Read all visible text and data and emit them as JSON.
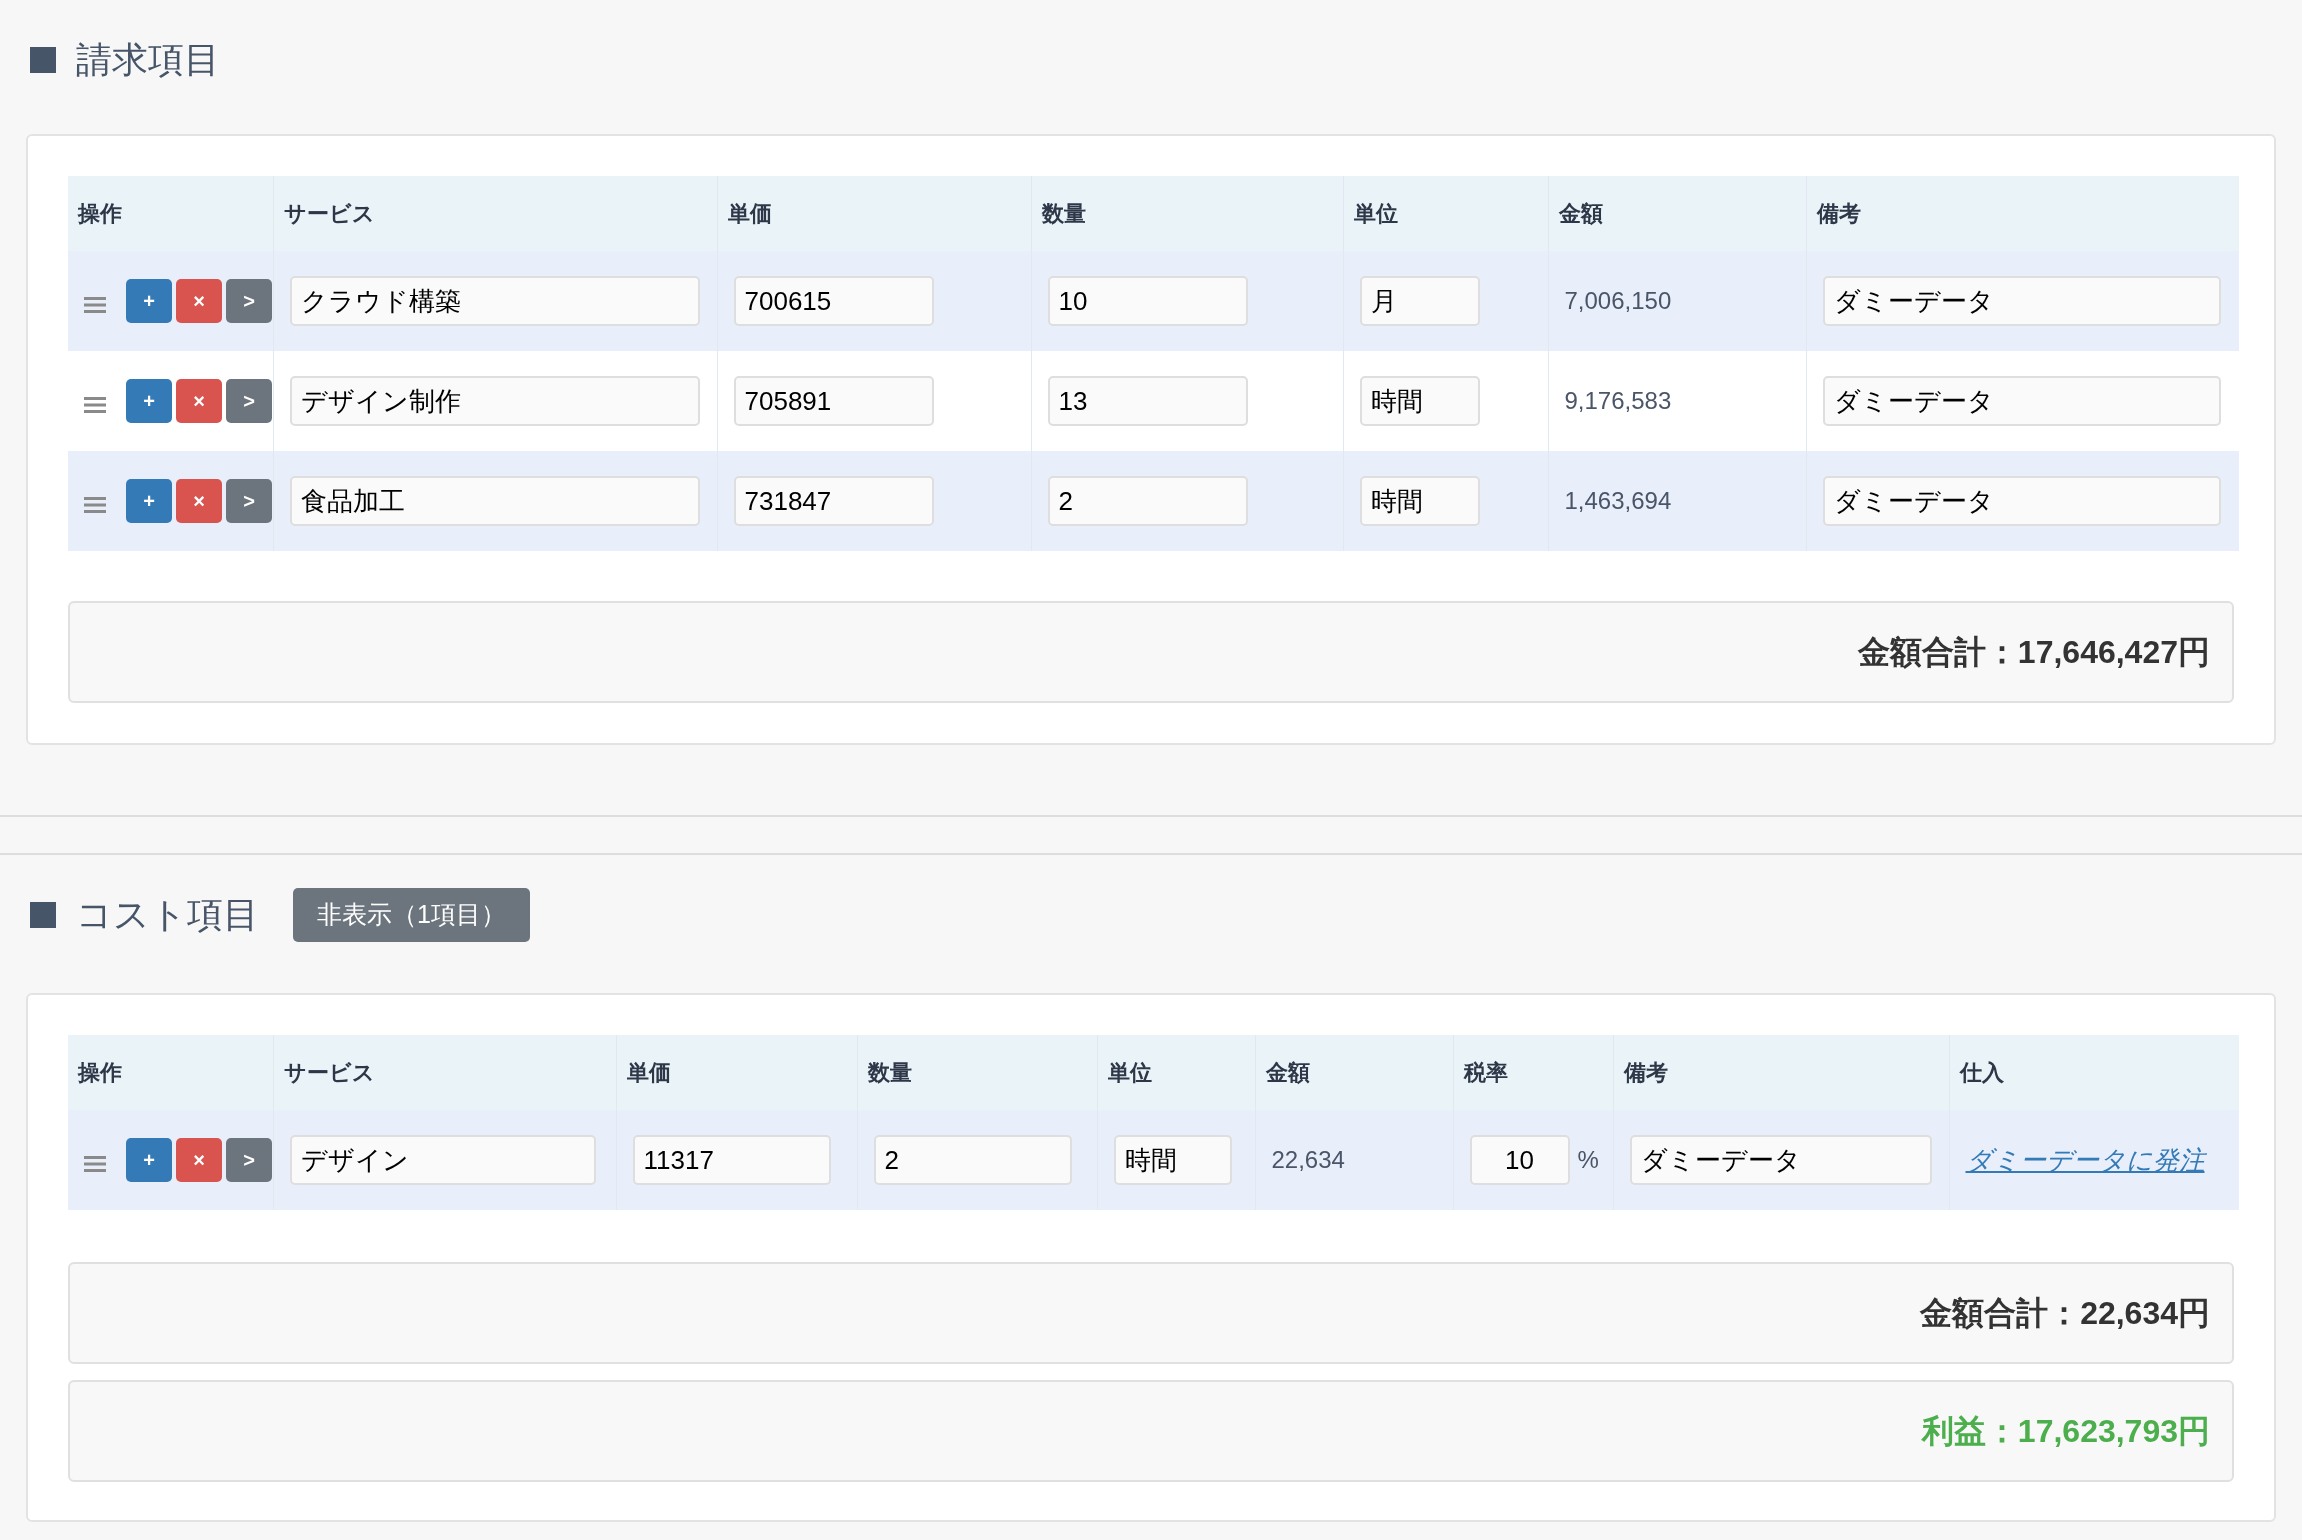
{
  "billing": {
    "title": "請求項目",
    "columns": [
      "操作",
      "サービス",
      "単価",
      "数量",
      "単位",
      "金額",
      "備考"
    ],
    "rows": [
      {
        "actions": [
          "+",
          "×",
          ">"
        ],
        "service": "クラウド構築",
        "price": "700615",
        "quantity": "10",
        "unit": "月",
        "amount": "7,006,150",
        "memo": "ダミーデータ"
      },
      {
        "actions": [
          "+",
          "×",
          ">"
        ],
        "service": "デザイン制作",
        "price": "705891",
        "quantity": "13",
        "unit": "時間",
        "amount": "9,176,583",
        "memo": "ダミーデータ"
      },
      {
        "actions": [
          "+",
          "×",
          ">"
        ],
        "service": "食品加工",
        "price": "731847",
        "quantity": "2",
        "unit": "時間",
        "amount": "1,463,694",
        "memo": "ダミーデータ"
      }
    ],
    "total": "金額合計：17,646,427円"
  },
  "cost": {
    "title": "コスト項目",
    "toggle_button": "非表示（1項目）",
    "columns": [
      "操作",
      "サービス",
      "単価",
      "数量",
      "単位",
      "金額",
      "税率",
      "備考",
      "仕入"
    ],
    "rows": [
      {
        "actions": [
          "+",
          "×",
          ">"
        ],
        "service": "デザイン",
        "price": "11317",
        "quantity": "2",
        "unit": "時間",
        "amount": "22,634",
        "tax_rate": "10",
        "tax_suffix": "%",
        "memo": "ダミーデータ",
        "purchase_link": "ダミーデータに発注"
      }
    ],
    "total": "金額合計：22,634円",
    "profit": "利益：17,623,793円"
  }
}
